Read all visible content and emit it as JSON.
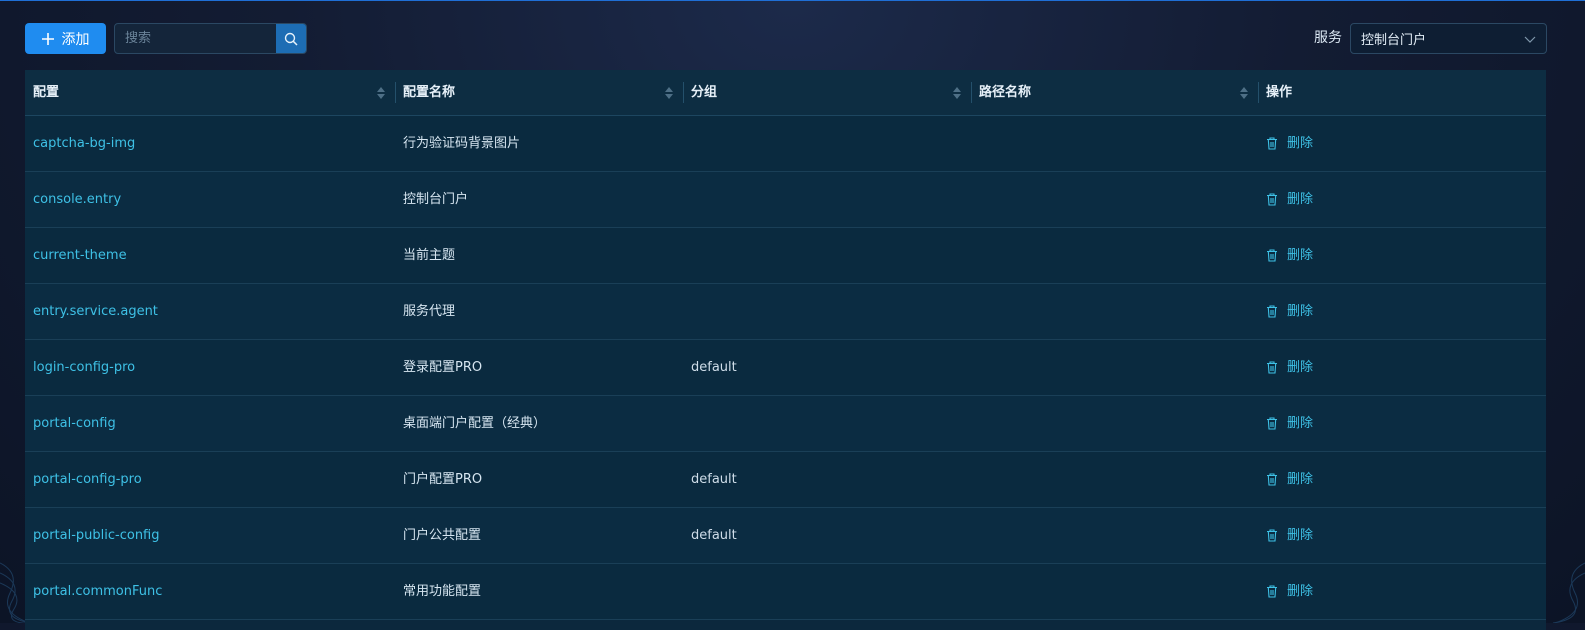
{
  "toolbar": {
    "add_label": "添加",
    "search_placeholder": "搜索",
    "service_label": "服务",
    "service_selected": "控制台门户"
  },
  "table": {
    "columns": [
      "配置",
      "配置名称",
      "分组",
      "路径名称",
      "操作"
    ],
    "delete_label": "删除",
    "rows": [
      {
        "key": "captcha-bg-img",
        "name": "行为验证码背景图片",
        "group": "",
        "path": ""
      },
      {
        "key": "console.entry",
        "name": "控制台门户",
        "group": "",
        "path": ""
      },
      {
        "key": "current-theme",
        "name": "当前主题",
        "group": "",
        "path": ""
      },
      {
        "key": "entry.service.agent",
        "name": "服务代理",
        "group": "",
        "path": ""
      },
      {
        "key": "login-config-pro",
        "name": "登录配置PRO",
        "group": "default",
        "path": ""
      },
      {
        "key": "portal-config",
        "name": "桌面端门户配置（经典）",
        "group": "",
        "path": ""
      },
      {
        "key": "portal-config-pro",
        "name": "门户配置PRO",
        "group": "default",
        "path": ""
      },
      {
        "key": "portal-public-config",
        "name": "门户公共配置",
        "group": "default",
        "path": ""
      },
      {
        "key": "portal.commonFunc",
        "name": "常用功能配置",
        "group": "",
        "path": ""
      }
    ]
  },
  "colors": {
    "accent": "#1f8cf0",
    "link": "#3ec1e6"
  },
  "icons": {
    "add": "plus-icon",
    "search": "search-icon",
    "dropdown": "chevron-down-icon",
    "sort": "sort-icon",
    "delete": "trash-icon"
  }
}
